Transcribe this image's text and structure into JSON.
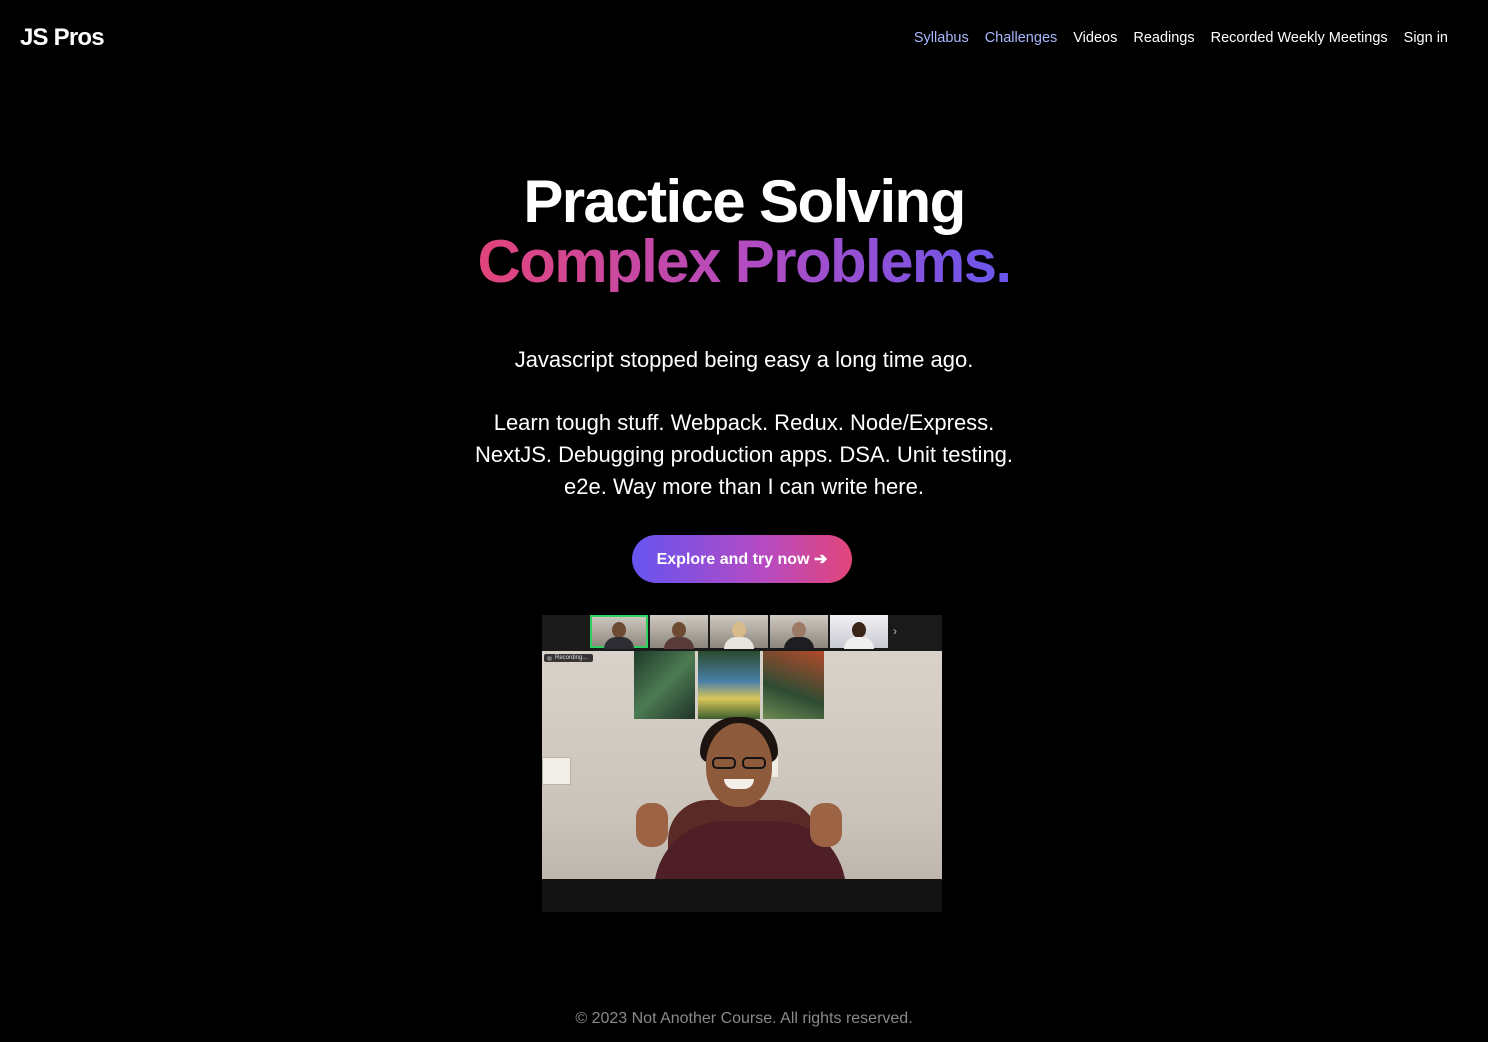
{
  "header": {
    "logo": "JS Pros",
    "nav": [
      {
        "label": "Syllabus",
        "active": true
      },
      {
        "label": "Challenges",
        "active": true
      },
      {
        "label": "Videos",
        "active": false
      },
      {
        "label": "Readings",
        "active": false
      },
      {
        "label": "Recorded Weekly Meetings",
        "active": false
      },
      {
        "label": "Sign in",
        "active": false
      }
    ]
  },
  "hero": {
    "title_line1": "Practice Solving",
    "title_line2": "Complex Problems.",
    "tagline": "Javascript stopped being easy a long time ago.",
    "description_lines": [
      "Learn tough stuff. Webpack. Redux. Node/Express.",
      "NextJS. Debugging production apps. DSA. Unit testing.",
      "e2e. Way more than I can write here."
    ],
    "cta_label": "Explore and try now ➔"
  },
  "video": {
    "recording_label": "Recording...",
    "next_label": "›"
  },
  "footer": {
    "copyright": "© 2023 Not Another Course. All rights reserved."
  },
  "colors": {
    "background": "#000000",
    "nav_active": "#a9b7ff",
    "gradient_start": "#e2447a",
    "gradient_end": "#6957ee"
  }
}
